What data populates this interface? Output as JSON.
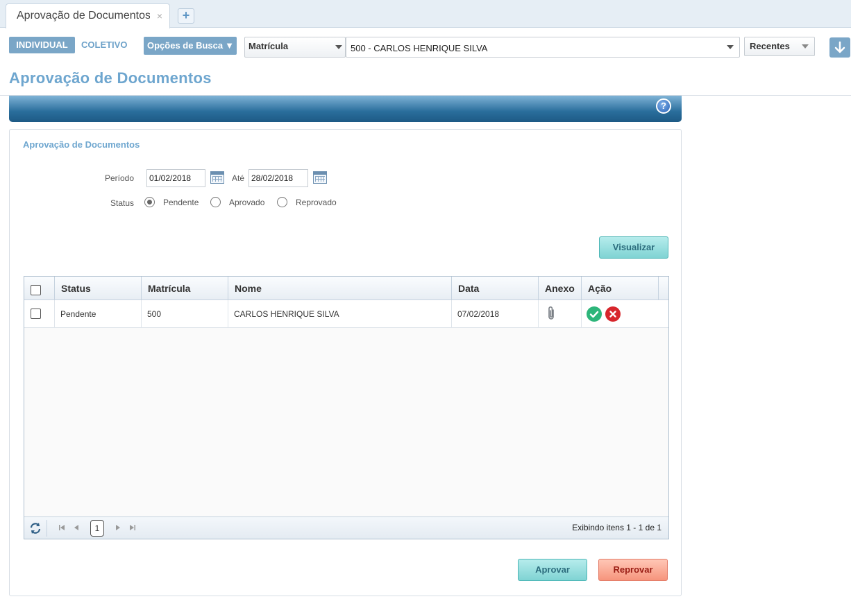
{
  "tab": {
    "title": "Aprovação de Documentos",
    "close": "×",
    "add": "+"
  },
  "toolbar": {
    "individual": "INDIVIDUAL",
    "coletivo": "COLETIVO",
    "opcoes_busca": "Opções de Busca",
    "opcoes_caret": "▼",
    "search_type": "Matrícula",
    "selected_person": "500 - CARLOS HENRIQUE SILVA",
    "recentes": "Recentes"
  },
  "page_title": "Aprovação de Documentos",
  "help": "?",
  "panel": {
    "title": "Aprovação de Documentos",
    "periodo_label": "Período",
    "date_from": "01/02/2018",
    "ate_label": "Até",
    "date_to": "28/02/2018",
    "status_label": "Status",
    "status_options": [
      "Pendente",
      "Aprovado",
      "Reprovado"
    ],
    "status_selected": "Pendente",
    "visualizar": "Visualizar"
  },
  "grid": {
    "columns": [
      "Status",
      "Matrícula",
      "Nome",
      "Data",
      "Anexo",
      "Ação"
    ],
    "rows": [
      {
        "status": "Pendente",
        "matricula": "500",
        "nome": "CARLOS HENRIQUE SILVA",
        "data": "07/02/2018",
        "anexo": "paperclip-icon",
        "acao": [
          "approve-icon",
          "reject-icon"
        ]
      }
    ],
    "page": "1",
    "info": "Exibindo itens 1 - 1 de 1"
  },
  "actions": {
    "aprovar": "Aprovar",
    "reprovar": "Reprovar"
  },
  "colors": {
    "accent": "#6ea6cf",
    "bar": "#2a6e9c",
    "approve": "#2db57a",
    "reject": "#d7262c"
  }
}
